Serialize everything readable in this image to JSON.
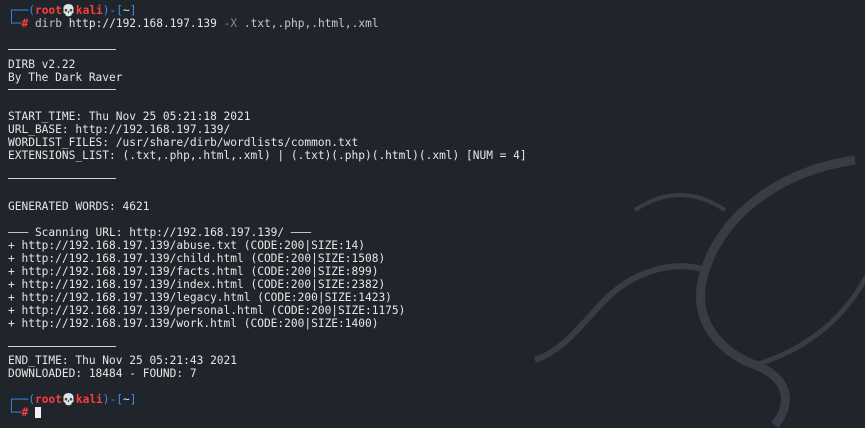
{
  "prompt": {
    "user": "root",
    "skull": "💀",
    "host": "kali",
    "dir": "~",
    "symbol": "#"
  },
  "command": {
    "program": "dirb",
    "url": "http://192.168.197.139",
    "flag": "-X",
    "extensions": ".txt,.php,.html,.xml"
  },
  "banner": {
    "version": "DIRB v2.22",
    "author": "By The Dark Raver"
  },
  "info": {
    "start_time": "START_TIME: Thu Nov 25 05:21:18 2021",
    "url_base": "URL_BASE: http://192.168.197.139/",
    "wordlist": "WORDLIST_FILES: /usr/share/dirb/wordlists/common.txt",
    "extensions": "EXTENSIONS_LIST: (.txt,.php,.html,.xml) | (.txt)(.php)(.html)(.xml) [NUM = 4]"
  },
  "generated": "GENERATED WORDS: 4621",
  "scanning": "——— Scanning URL: http://192.168.197.139/ ———",
  "results": [
    "+ http://192.168.197.139/abuse.txt (CODE:200|SIZE:14)",
    "+ http://192.168.197.139/child.html (CODE:200|SIZE:1508)",
    "+ http://192.168.197.139/facts.html (CODE:200|SIZE:899)",
    "+ http://192.168.197.139/index.html (CODE:200|SIZE:2382)",
    "+ http://192.168.197.139/legacy.html (CODE:200|SIZE:1423)",
    "+ http://192.168.197.139/personal.html (CODE:200|SIZE:1175)",
    "+ http://192.168.197.139/work.html (CODE:200|SIZE:1400)"
  ],
  "summary": {
    "end_time": "END_TIME: Thu Nov 25 05:21:43 2021",
    "downloaded": "DOWNLOADED: 18484 - FOUND: 7"
  },
  "colors": {
    "background": "#20242b",
    "prompt_blue": "#3b8eea",
    "prompt_red": "#ff3b3b",
    "text": "#e6e6e6"
  }
}
